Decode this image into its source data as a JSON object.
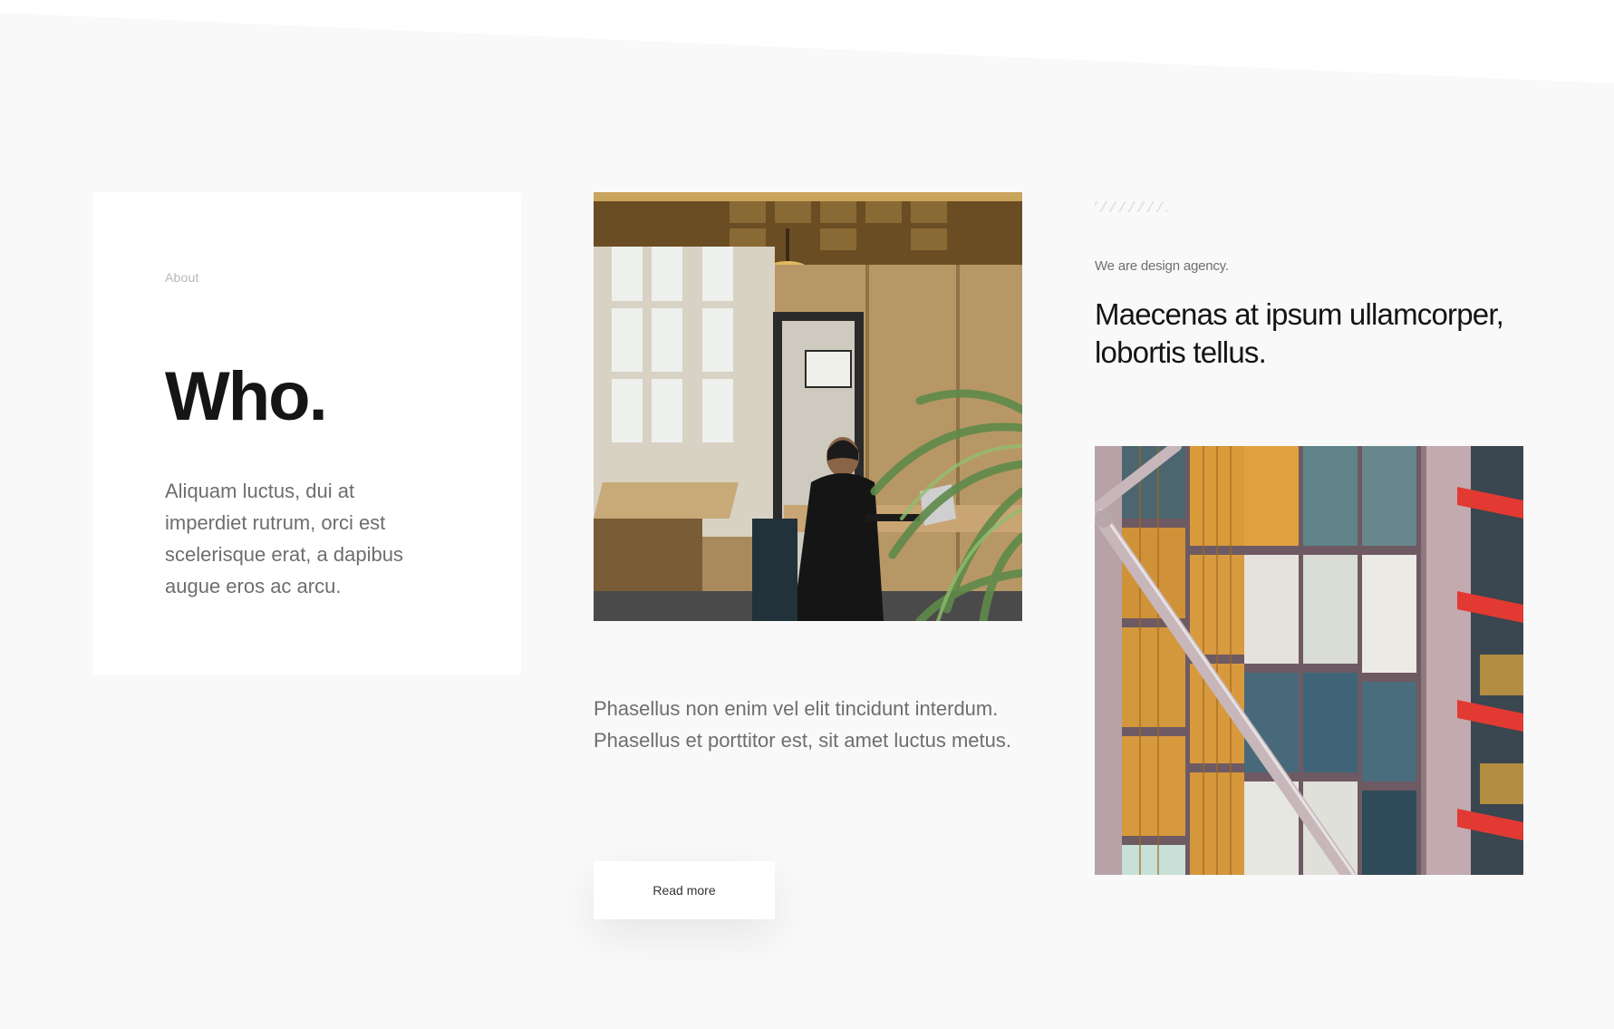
{
  "about_card": {
    "label": "About",
    "title": "Who.",
    "body": "Aliquam luctus, dui at imperdiet rutrum, orci est scelerisque erat, a dapibus augue eros ac arcu."
  },
  "middle": {
    "image": "office-photo",
    "body": "Phasellus non enim vel elit tincidunt interdum. Phasellus et porttitor est, sit amet luctus metus.",
    "button_label": "Read more"
  },
  "right": {
    "tagline": "We are design agency.",
    "title": "Maecenas at ipsum ullamcorper, lobortis tellus.",
    "image": "building-photo"
  },
  "colors": {
    "background": "#f9f9f9",
    "card": "#ffffff",
    "heading": "#151515",
    "body_text": "#6e6e6e"
  }
}
